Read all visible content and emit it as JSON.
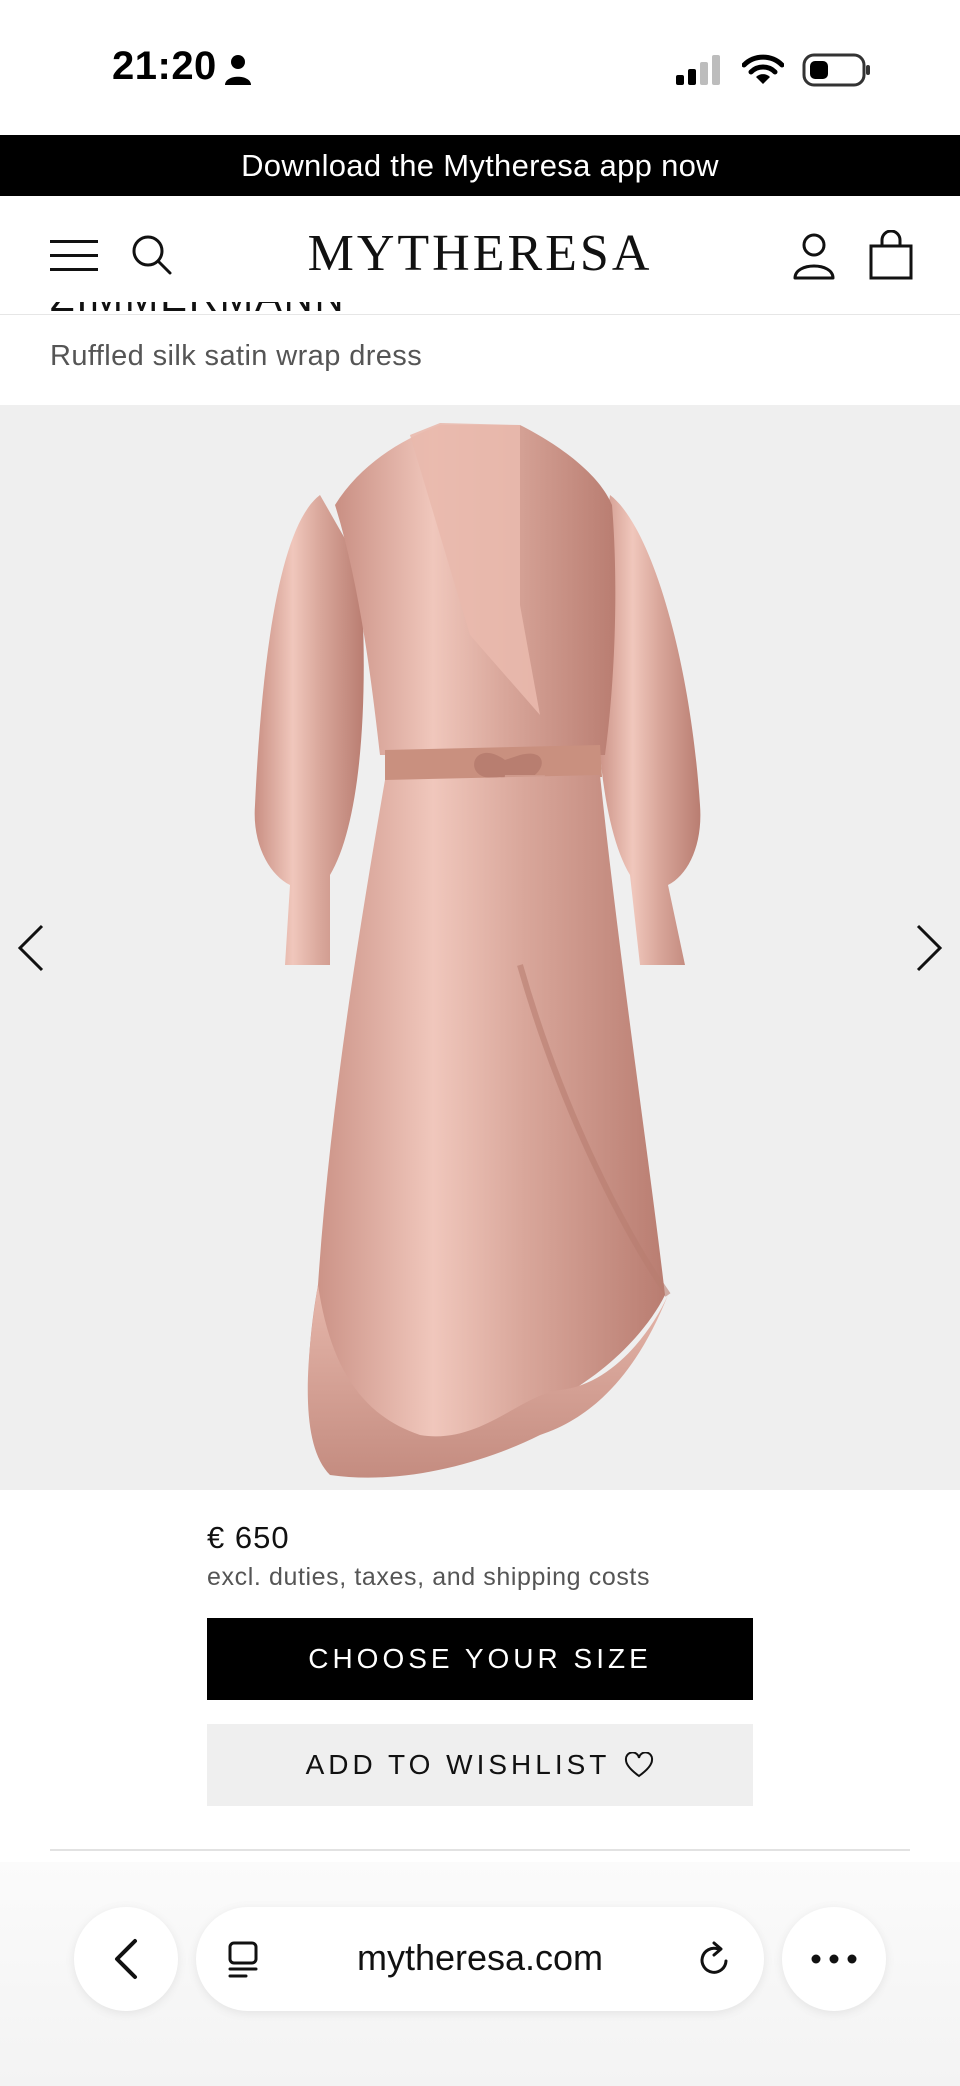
{
  "status_bar": {
    "time": "21:20"
  },
  "promo_banner": {
    "text": "Download the Mytheresa app now"
  },
  "header": {
    "logo": "MYTHERESA"
  },
  "product": {
    "brand": "ZIMMERMANN",
    "title": "Ruffled silk satin wrap dress",
    "price": "€ 650",
    "price_note": "excl. duties, taxes, and shipping costs",
    "image_color": "#d9a79b"
  },
  "actions": {
    "choose_size": "CHOOSE YOUR SIZE",
    "add_to_wishlist": "ADD TO WISHLIST"
  },
  "browser": {
    "url": "mytheresa.com"
  },
  "icons": {
    "menu": "hamburger-icon",
    "search": "search-icon",
    "account": "user-icon",
    "bag": "shopping-bag-icon",
    "prev": "chevron-left-icon",
    "next": "chevron-right-icon",
    "wishlist": "heart-icon",
    "back": "back-icon",
    "tabs": "tabs-icon",
    "reload": "reload-icon",
    "more": "more-icon"
  },
  "colors": {
    "banner_bg": "#000000",
    "image_bg": "#efefef",
    "primary_button": "#000000",
    "secondary_button": "#efefef"
  }
}
